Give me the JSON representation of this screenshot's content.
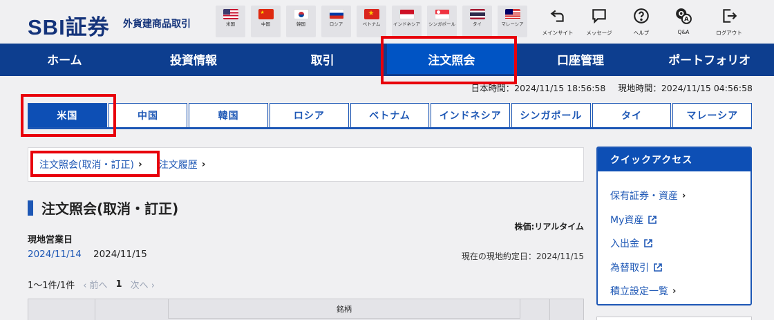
{
  "header": {
    "logo": "SBI証券",
    "subtitle": "外貨建商品取引",
    "flags": [
      {
        "label": "米国",
        "icon": "us-flag-icon"
      },
      {
        "label": "中国",
        "icon": "cn-flag-icon"
      },
      {
        "label": "韓国",
        "icon": "kr-flag-icon"
      },
      {
        "label": "ロシア",
        "icon": "ru-flag-icon"
      },
      {
        "label": "ベトナム",
        "icon": "vn-flag-icon"
      },
      {
        "label": "インドネシア",
        "icon": "id-flag-icon"
      },
      {
        "label": "シンガポール",
        "icon": "sg-flag-icon"
      },
      {
        "label": "タイ",
        "icon": "th-flag-icon"
      },
      {
        "label": "マレーシア",
        "icon": "my-flag-icon"
      }
    ],
    "utilities": [
      {
        "label": "メインサイト",
        "icon": "return-icon"
      },
      {
        "label": "メッセージ",
        "icon": "message-icon"
      },
      {
        "label": "ヘルプ",
        "icon": "help-icon"
      },
      {
        "label": "Q&A",
        "icon": "qa-icon"
      },
      {
        "label": "ログアウト",
        "icon": "logout-icon"
      }
    ]
  },
  "mainnav": {
    "items": [
      "ホーム",
      "投資情報",
      "取引",
      "注文照会",
      "口座管理",
      "ポートフォリオ"
    ],
    "active": "注文照会"
  },
  "times": {
    "japan": "日本時間：2024/11/15 18:56:58",
    "local": "現地時間：2024/11/15 04:56:58"
  },
  "country_tabs": {
    "items": [
      "米国",
      "中国",
      "韓国",
      "ロシア",
      "ベトナム",
      "インドネシア",
      "シンガポール",
      "タイ",
      "マレーシア"
    ],
    "active": "米国"
  },
  "breadcrumb": {
    "current": "注文照会(取消・訂正)",
    "other": "注文履歴",
    "chevron": "›"
  },
  "page": {
    "title": "注文照会(取消・訂正)",
    "price_mode": "株価:リアルタイム",
    "bizday_label": "現地営業日",
    "date_prev": "2024/11/14",
    "date_current": "2024/11/15",
    "settlement": "現在の現地約定日：2024/11/15"
  },
  "pager": {
    "count": "1～1件/1件",
    "prev": "‹ 前へ",
    "current": "1",
    "next": "次へ ›"
  },
  "table": {
    "header_meigara": "銘柄"
  },
  "quick_access": {
    "title": "クイックアクセス",
    "items": [
      {
        "label": "保有証券・資産",
        "tail": "›",
        "icon": "chevron-right-icon"
      },
      {
        "label": "My資産",
        "tail": "",
        "icon": "external-link-icon"
      },
      {
        "label": "入出金",
        "tail": "",
        "icon": "external-link-icon"
      },
      {
        "label": "為替取引",
        "tail": "",
        "icon": "external-link-icon"
      },
      {
        "label": "積立設定一覧",
        "tail": "›",
        "icon": "chevron-right-icon"
      }
    ]
  },
  "colors": {
    "brand_navy": "#0d3e8f",
    "active_blue": "#0054c4",
    "link_blue": "#1d57b5",
    "highlight_red": "#e8000b"
  }
}
